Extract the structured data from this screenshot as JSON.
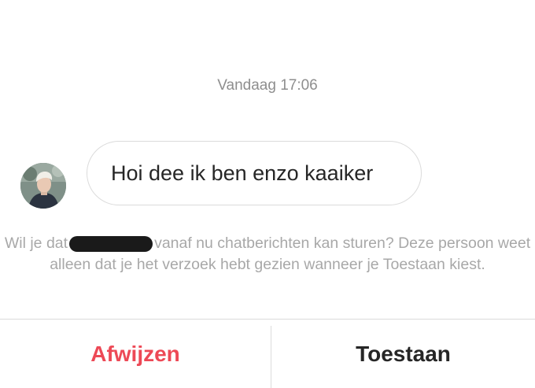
{
  "thread": {
    "timestamp": "Vandaag 17:06",
    "message": {
      "text": "Hoi dee ik ben enzo kaaiker",
      "sender_avatar": "profile-photo"
    }
  },
  "request": {
    "text_before_redaction": "Wil je dat",
    "text_after_redaction": "vanaf nu chatberichten kan sturen? Deze persoon weet alleen dat je het verzoek hebt gezien wanneer je Toestaan kiest."
  },
  "actions": {
    "decline_label": "Afwijzen",
    "accept_label": "Toestaan",
    "decline_color": "#ed4956",
    "accept_color": "#262626"
  }
}
